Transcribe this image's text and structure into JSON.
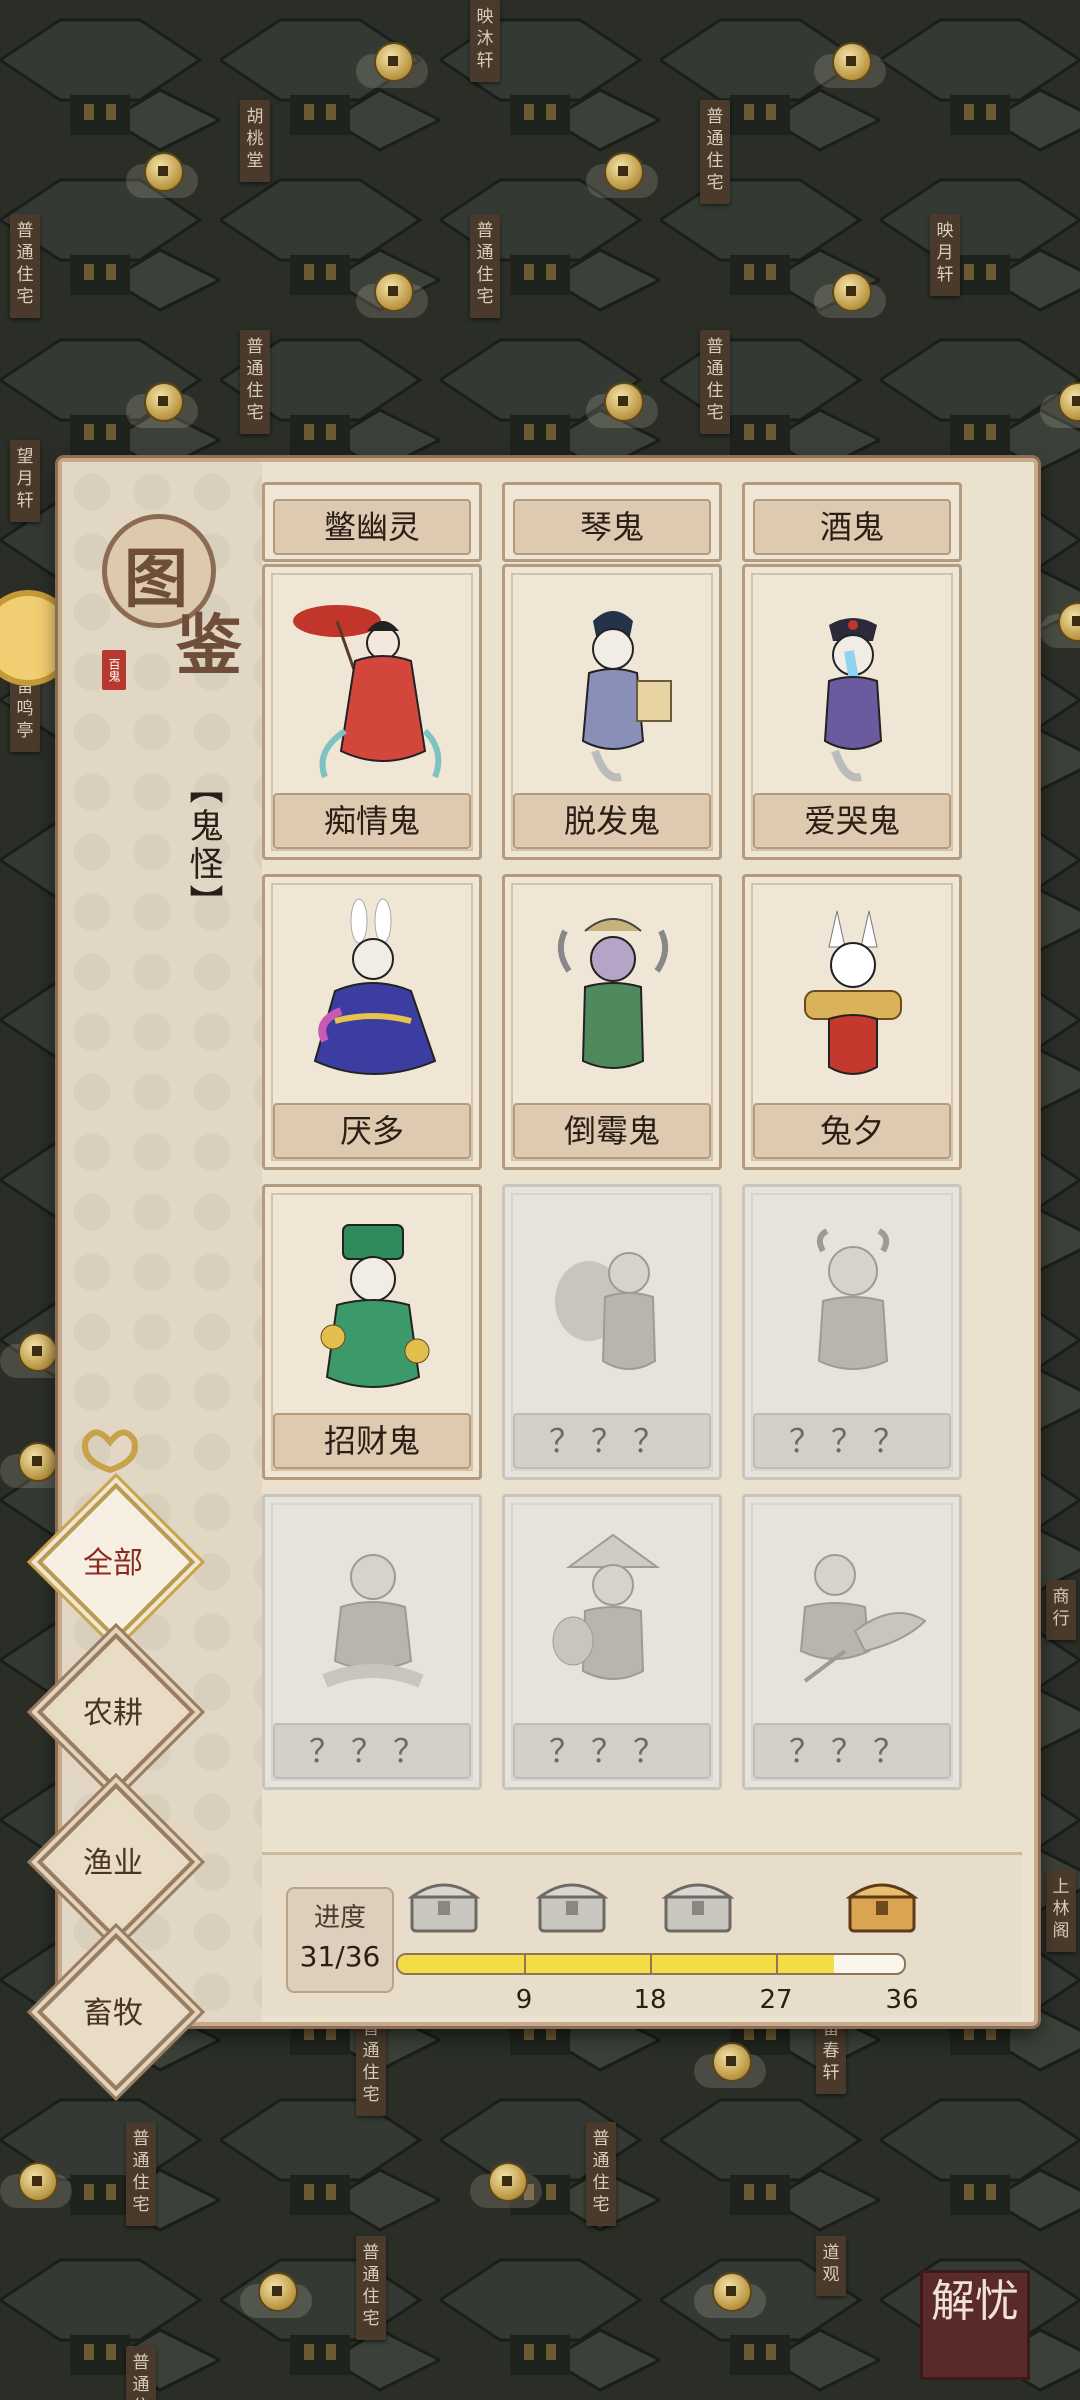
{
  "map_labels": [
    "映沐轩",
    "胡桃堂",
    "普通住宅",
    "普通住宅",
    "映月轩",
    "普通住宅",
    "普通住宅",
    "普通住宅",
    "望月轩",
    "留鸣亭",
    "商行",
    "上林阁",
    "普通住宅",
    "普通住宅",
    "留春轩",
    "普通住宅",
    "普通住宅",
    "道观",
    "普通住宅"
  ],
  "codex": {
    "title_char1": "图",
    "title_char2": "鉴",
    "seal_text": "百鬼",
    "category": "【鬼怪】",
    "entries": [
      {
        "name": "鳖幽灵",
        "unlocked": true,
        "partial": true
      },
      {
        "name": "琴鬼",
        "unlocked": true,
        "partial": true
      },
      {
        "name": "酒鬼",
        "unlocked": true,
        "partial": true
      },
      {
        "name": "痴情鬼",
        "unlocked": true,
        "partial": false
      },
      {
        "name": "脱发鬼",
        "unlocked": true,
        "partial": false
      },
      {
        "name": "爱哭鬼",
        "unlocked": true,
        "partial": false
      },
      {
        "name": "厌多",
        "unlocked": true,
        "partial": false
      },
      {
        "name": "倒霉鬼",
        "unlocked": true,
        "partial": false
      },
      {
        "name": "兔夕",
        "unlocked": true,
        "partial": false
      },
      {
        "name": "招财鬼",
        "unlocked": true,
        "partial": false
      },
      {
        "name": "？？？",
        "unlocked": false,
        "partial": false
      },
      {
        "name": "？？？",
        "unlocked": false,
        "partial": false
      },
      {
        "name": "？？？",
        "unlocked": false,
        "partial": false
      },
      {
        "name": "？？？",
        "unlocked": false,
        "partial": false
      },
      {
        "name": "？？？",
        "unlocked": false,
        "partial": false
      }
    ]
  },
  "progress": {
    "title": "进度",
    "value_text": "31/36",
    "current": 31,
    "total": 36,
    "milestones": [
      "9",
      "18",
      "27",
      "36"
    ]
  },
  "filters": [
    {
      "label": "全部",
      "active": true
    },
    {
      "label": "农耕",
      "active": false
    },
    {
      "label": "渔业",
      "active": false
    },
    {
      "label": "畜牧",
      "active": false
    }
  ],
  "corner_badge": "解忧",
  "colors": {
    "panel_bg": "#ebe1cf",
    "panel_border": "#c7a98b",
    "progress_fill": "#f4dc47",
    "seal_red": "#b6382e"
  }
}
